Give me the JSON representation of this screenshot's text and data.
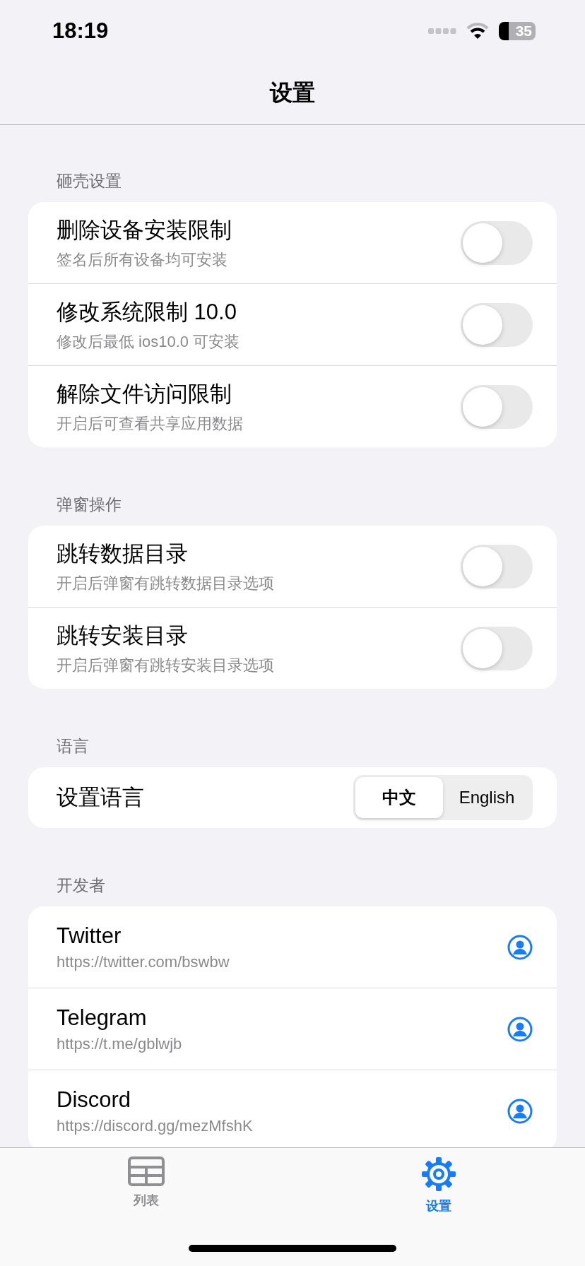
{
  "status_bar": {
    "time": "18:19",
    "battery": "35"
  },
  "nav": {
    "title": "设置"
  },
  "sections": [
    {
      "header": "砸壳设置",
      "items": [
        {
          "kind": "toggle",
          "title": "删除设备安装限制",
          "subtitle": "签名后所有设备均可安装",
          "on": false
        },
        {
          "kind": "toggle",
          "title": "修改系统限制 10.0",
          "subtitle": "修改后最低 ios10.0 可安装",
          "on": false
        },
        {
          "kind": "toggle",
          "title": "解除文件访问限制",
          "subtitle": "开启后可查看共享应用数据",
          "on": false
        }
      ]
    },
    {
      "header": "弹窗操作",
      "items": [
        {
          "kind": "toggle",
          "title": "跳转数据目录",
          "subtitle": "开启后弹窗有跳转数据目录选项",
          "on": false
        },
        {
          "kind": "toggle",
          "title": "跳转安装目录",
          "subtitle": "开启后弹窗有跳转安装目录选项",
          "on": false
        }
      ]
    },
    {
      "header": "语言",
      "items": [
        {
          "kind": "segmented",
          "title": "设置语言",
          "options": [
            {
              "label": "中文",
              "selected": true
            },
            {
              "label": "English",
              "selected": false
            }
          ]
        }
      ]
    },
    {
      "header": "开发者",
      "items": [
        {
          "kind": "link",
          "title": "Twitter",
          "subtitle": "https://twitter.com/bswbw"
        },
        {
          "kind": "link",
          "title": "Telegram",
          "subtitle": "https://t.me/gblwjb"
        },
        {
          "kind": "link",
          "title": "Discord",
          "subtitle": "https://discord.gg/mezMfshK"
        }
      ]
    }
  ],
  "tab_bar": [
    {
      "label": "列表",
      "kind": "grid",
      "selected": false
    },
    {
      "label": "设置",
      "kind": "gear",
      "selected": true
    }
  ]
}
